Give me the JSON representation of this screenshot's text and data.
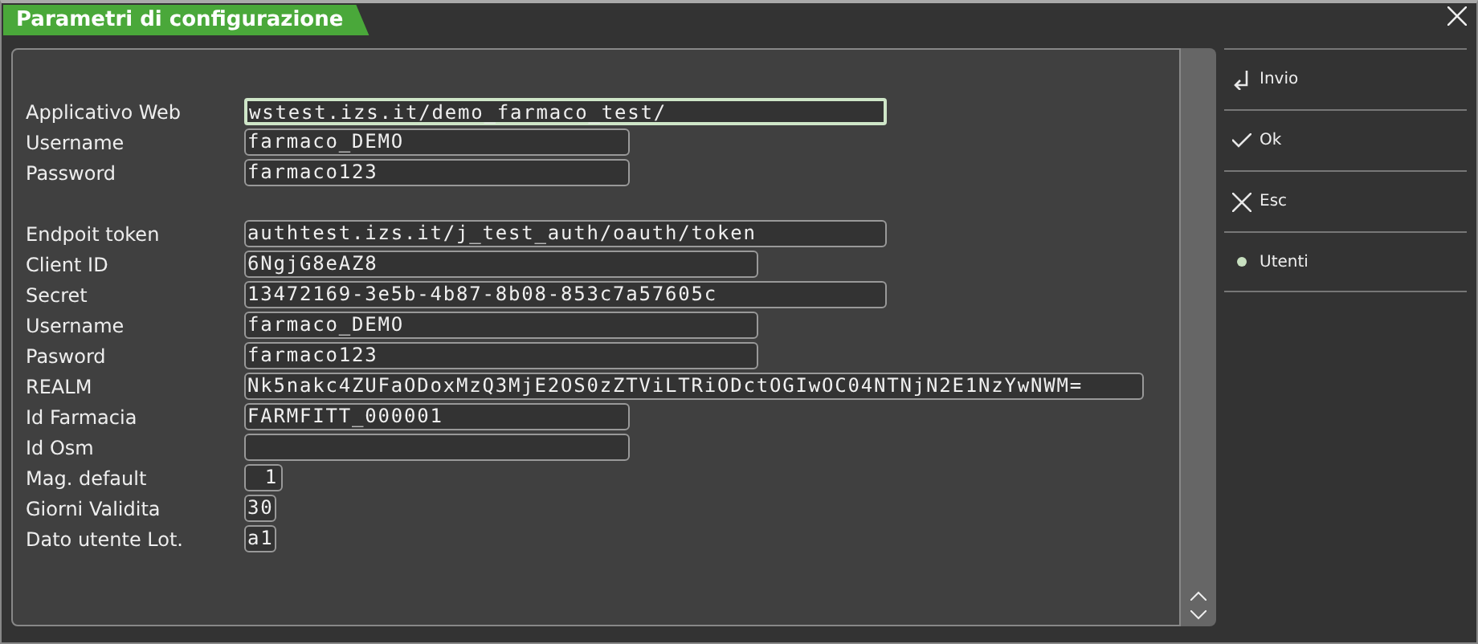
{
  "window": {
    "title": "Parametri di configurazione"
  },
  "sections": [
    {
      "fields": [
        {
          "label": "Applicativo Web",
          "value": "wstest.izs.it/demo_farmaco_test/",
          "kind": "long",
          "focused": true
        },
        {
          "label": "Username",
          "value": "farmaco_DEMO",
          "kind": "text",
          "focused": false
        },
        {
          "label": "Password",
          "value": "farmaco123",
          "kind": "text",
          "focused": false
        }
      ]
    },
    {
      "fields": [
        {
          "label": "Endpoit token",
          "value": "authtest.izs.it/j_test_auth/oauth/token",
          "kind": "long",
          "focused": false
        },
        {
          "label": "Client ID",
          "value": "6NgjG8eAZ8",
          "kind": "medium",
          "focused": false
        },
        {
          "label": "Secret",
          "value": "13472169-3e5b-4b87-8b08-853c7a57605c",
          "kind": "long",
          "focused": false
        },
        {
          "label": "Username",
          "value": "farmaco_DEMO",
          "kind": "medium",
          "focused": false
        },
        {
          "label": "Pasword",
          "value": "farmaco123",
          "kind": "medium",
          "focused": false
        },
        {
          "label": "REALM",
          "value": "Nk5nakc4ZUFaODoxMzQ3MjE2OS0zZTViLTRiODctOGIwOC04NTNjN2E1NzYwNWM=",
          "kind": "wide",
          "focused": false
        },
        {
          "label": "Id Farmacia",
          "value": "FARMFITT_000001",
          "kind": "text",
          "focused": false
        },
        {
          "label": "Id Osm",
          "kind": "text",
          "focused": false
        },
        {
          "label": "Mag. default",
          "value": "1",
          "kind": "number",
          "focused": false
        },
        {
          "label": "Giorni Validita",
          "value": "30",
          "kind": "tiny",
          "focused": false
        },
        {
          "label": "Dato utente Lot.",
          "value": "a1",
          "kind": "tiny",
          "focused": false
        }
      ]
    }
  ],
  "actions": [
    {
      "label": "Invio"
    },
    {
      "label": "Ok"
    },
    {
      "label": "Esc"
    },
    {
      "label": "Utenti"
    }
  ]
}
